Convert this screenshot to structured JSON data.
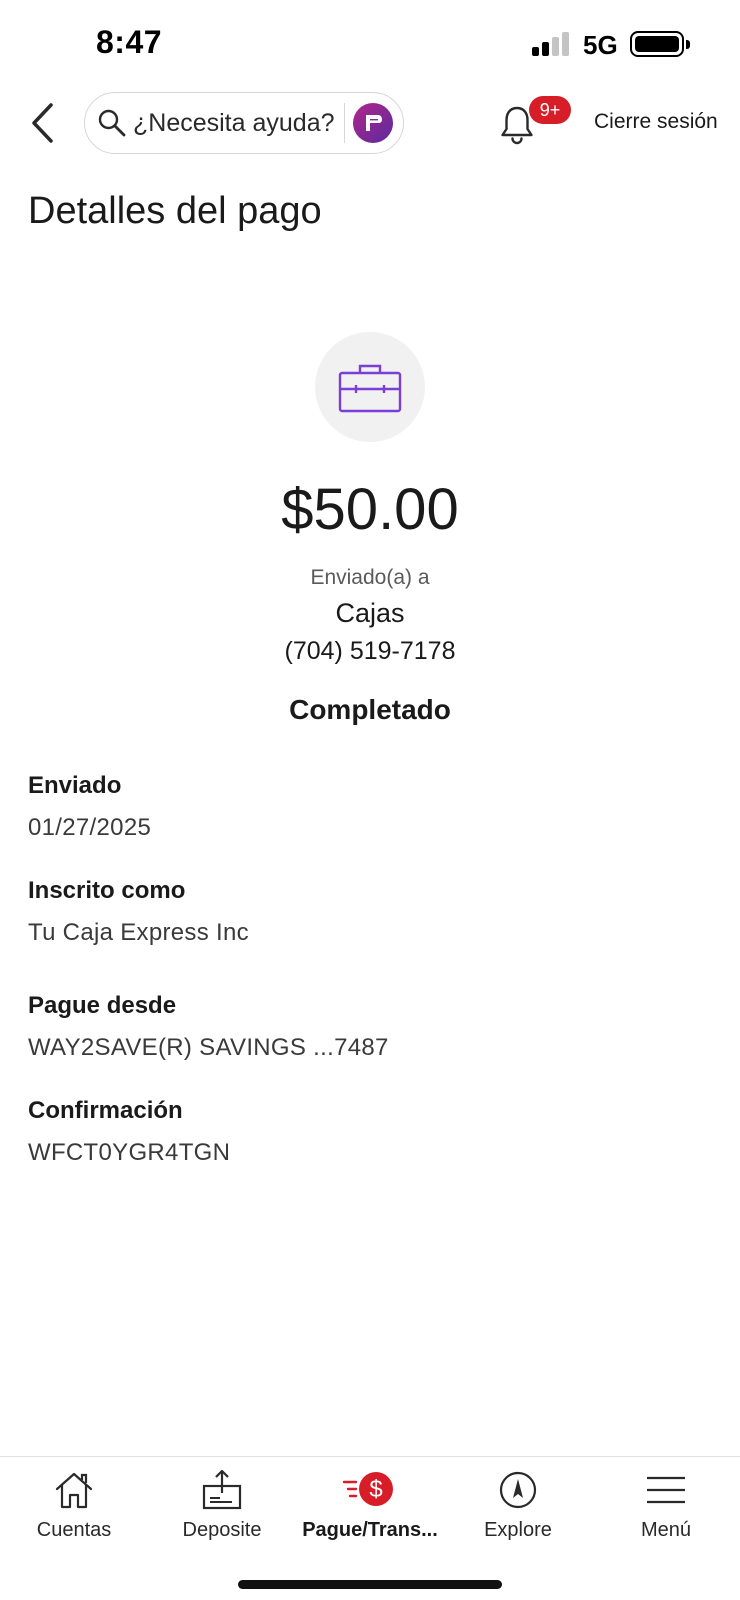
{
  "status_bar": {
    "time": "8:47",
    "network": "5G"
  },
  "header": {
    "search_placeholder": "¿Necesita ayuda?",
    "notifications_badge": "9+",
    "logout_label": "Cierre sesión"
  },
  "page": {
    "title": "Detalles del pago"
  },
  "payment": {
    "amount": "$50.00",
    "sent_to_label": "Enviado(a) a",
    "recipient_name": "Cajas",
    "recipient_phone": "(704) 519-7178",
    "status": "Completado"
  },
  "details": [
    {
      "label": "Enviado",
      "value": "01/27/2025"
    },
    {
      "label": "Inscrito como",
      "value": "Tu Caja Express Inc"
    },
    {
      "label": "Pague desde",
      "value": "WAY2SAVE(R) SAVINGS ...7487"
    },
    {
      "label": "Confirmación",
      "value": "WFCT0YGR4TGN"
    }
  ],
  "bottom_nav": [
    {
      "label": "Cuentas",
      "icon": "home-icon"
    },
    {
      "label": "Deposite",
      "icon": "deposit-icon"
    },
    {
      "label": "Pague/Trans...",
      "icon": "pay-transfer-icon",
      "active": true
    },
    {
      "label": "Explore",
      "icon": "compass-icon"
    },
    {
      "label": "Menú",
      "icon": "hamburger-menu-icon"
    }
  ],
  "colors": {
    "brand_red": "#d71e28",
    "brand_purple": "#5b2a9e",
    "icon_purple": "#7b3fd6",
    "hero_circle": "#f2f1f1"
  }
}
